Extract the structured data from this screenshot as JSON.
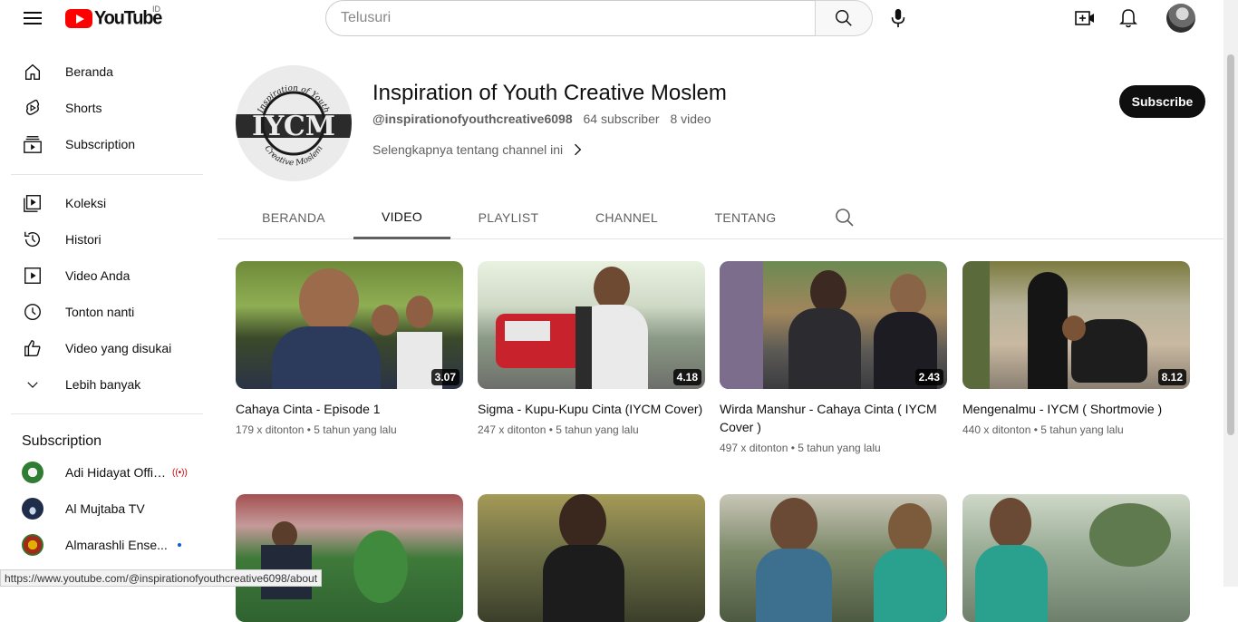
{
  "header": {
    "logo_text": "YouTube",
    "country_code": "ID",
    "search_placeholder": "Telusuri",
    "icons": [
      "menu-icon",
      "search-icon",
      "mic-icon",
      "create-icon",
      "bell-icon"
    ]
  },
  "sidebar": {
    "main": [
      {
        "label": "Beranda",
        "icon": "home-icon"
      },
      {
        "label": "Shorts",
        "icon": "shorts-icon"
      },
      {
        "label": "Subscription",
        "icon": "subscription-icon"
      }
    ],
    "library": [
      {
        "label": "Koleksi",
        "icon": "library-icon"
      },
      {
        "label": "Histori",
        "icon": "history-icon"
      },
      {
        "label": "Video Anda",
        "icon": "your-videos-icon"
      },
      {
        "label": "Tonton nanti",
        "icon": "watch-later-icon"
      },
      {
        "label": "Video yang disukai",
        "icon": "liked-icon"
      },
      {
        "label": "Lebih banyak",
        "icon": "chevron-down-icon"
      }
    ],
    "subscriptions_heading": "Subscription",
    "subscriptions": [
      {
        "label": "Adi Hidayat Offic...",
        "badge": "live",
        "badge_text": "((•))"
      },
      {
        "label": "Al Mujtaba TV",
        "badge": ""
      },
      {
        "label": "Almarashli Ense...",
        "badge": "new"
      }
    ]
  },
  "channel": {
    "name": "Inspiration of Youth Creative Moslem",
    "handle": "@inspirationofyouthcreative6098",
    "subscribers": "64 subscriber",
    "videos": "8 video",
    "more": "Selengkapnya tentang channel ini",
    "subscribe_label": "Subscribe",
    "avatar_text": "IYCM",
    "avatar_arc_top": "Inspiration of Youth",
    "avatar_arc_bottom": "Creative Moslem"
  },
  "tabs": [
    {
      "label": "BERANDA",
      "active": false
    },
    {
      "label": "VIDEO",
      "active": true
    },
    {
      "label": "PLAYLIST",
      "active": false
    },
    {
      "label": "CHANNEL",
      "active": false
    },
    {
      "label": "TENTANG",
      "active": false
    }
  ],
  "videos": [
    {
      "title": "Cahaya Cinta - Episode 1",
      "views": "179 x ditonton",
      "age": "5 tahun yang lalu",
      "duration": "3.07"
    },
    {
      "title": "Sigma - Kupu-Kupu Cinta (IYCM Cover)",
      "views": "247 x ditonton",
      "age": "5 tahun yang lalu",
      "duration": "4.18"
    },
    {
      "title": "Wirda Manshur - Cahaya Cinta ( IYCM Cover )",
      "views": "497 x ditonton",
      "age": "5 tahun yang lalu",
      "duration": "2.43"
    },
    {
      "title": "Mengenalmu - IYCM ( Shortmovie )",
      "views": "440 x ditonton",
      "age": "5 tahun yang lalu",
      "duration": "8.12"
    }
  ],
  "status_url": "https://www.youtube.com/@inspirationofyouthcreative6098/about",
  "colors": {
    "brand_red": "#ff0000",
    "text": "#0f0f0f",
    "secondary": "#606060"
  }
}
